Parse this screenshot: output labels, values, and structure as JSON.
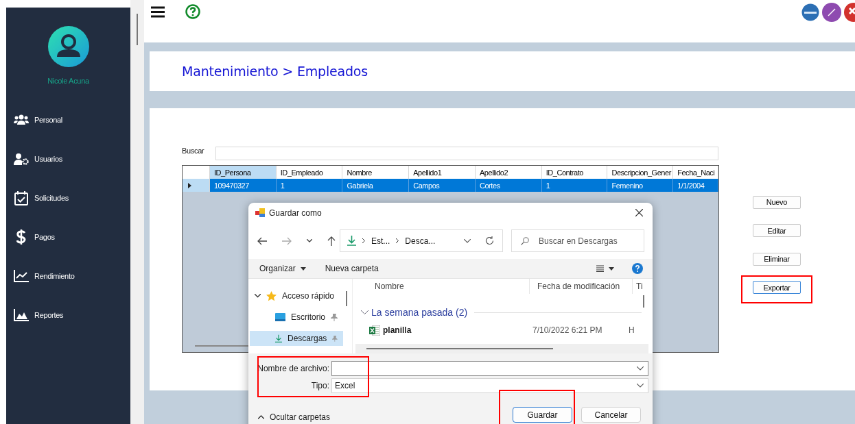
{
  "sidebar": {
    "user_name": "Nicole Acuna",
    "items": [
      {
        "kind": "people",
        "label": "Personal"
      },
      {
        "kind": "users",
        "label": "Usuarios"
      },
      {
        "kind": "requests",
        "label": "Solicitudes"
      },
      {
        "kind": "payments",
        "label": "Pagos"
      },
      {
        "kind": "performance",
        "label": "Rendimiento"
      },
      {
        "kind": "reports",
        "label": "Reportes"
      }
    ]
  },
  "breadcrumb": "Mantenimiento > Empleados",
  "search": {
    "label": "Buscar"
  },
  "grid": {
    "columns": [
      {
        "label": "ID_Persona",
        "selected": true
      },
      {
        "label": "ID_Empleado",
        "selected": false
      },
      {
        "label": "Nombre",
        "selected": false
      },
      {
        "label": "Apellido1",
        "selected": false
      },
      {
        "label": "Apellido2",
        "selected": false
      },
      {
        "label": "ID_Contrato",
        "selected": false
      },
      {
        "label": "Descripcion_Gener",
        "selected": false
      },
      {
        "label": "Fecha_Naci",
        "selected": false
      }
    ],
    "rows": [
      {
        "selected": true,
        "cells": [
          "109470327",
          "1",
          "Gabriela",
          "Campos",
          "Cortes",
          "1",
          "Femenino",
          "1/1/2004"
        ]
      }
    ]
  },
  "buttons": [
    {
      "label": "Nuevo",
      "focused": false,
      "highlighted": false
    },
    {
      "label": "Editar",
      "focused": false,
      "highlighted": false
    },
    {
      "label": "Eliminar",
      "focused": false,
      "highlighted": false
    },
    {
      "label": "Exportar",
      "focused": true,
      "highlighted": true
    }
  ],
  "dialog": {
    "title": "Guardar como",
    "nav_buttons": [
      {
        "kind": "back",
        "disabled": false
      },
      {
        "kind": "forward",
        "disabled": true
      },
      {
        "kind": "recent",
        "disabled": false
      },
      {
        "kind": "up",
        "disabled": false
      }
    ],
    "address": [
      "Est...",
      "Desca..."
    ],
    "search_placeholder": "Buscar en Descargas",
    "organize": "Organizar",
    "new_folder": "Nueva carpeta",
    "tree": [
      {
        "label": "Acceso rápido",
        "kind": "quick",
        "expanded": true,
        "selected": false,
        "children": [
          {
            "label": "Escritorio",
            "kind": "desktop",
            "pinned": true,
            "selected": false
          },
          {
            "label": "Descargas",
            "kind": "downloads",
            "pinned": true,
            "selected": true
          }
        ]
      }
    ],
    "columns": [
      "Nombre",
      "Fecha de modificación",
      "Ti"
    ],
    "groups": [
      {
        "label": "La semana pasada (2)",
        "expanded": true,
        "files": [
          {
            "name": "planilla",
            "kind": "spreadsheet",
            "modified": "7/10/2022 6:21 PM",
            "type": "H"
          }
        ]
      }
    ],
    "file_name_label": "Nombre de archivo:",
    "file_type_label": "Tipo:",
    "file_type": "Excel",
    "fields_highlighted": true,
    "hide_folders": "Ocultar carpetas",
    "buttons": [
      {
        "label": "Guardar",
        "default": true,
        "highlighted": true
      },
      {
        "label": "Cancelar",
        "default": false,
        "highlighted": false
      }
    ]
  }
}
